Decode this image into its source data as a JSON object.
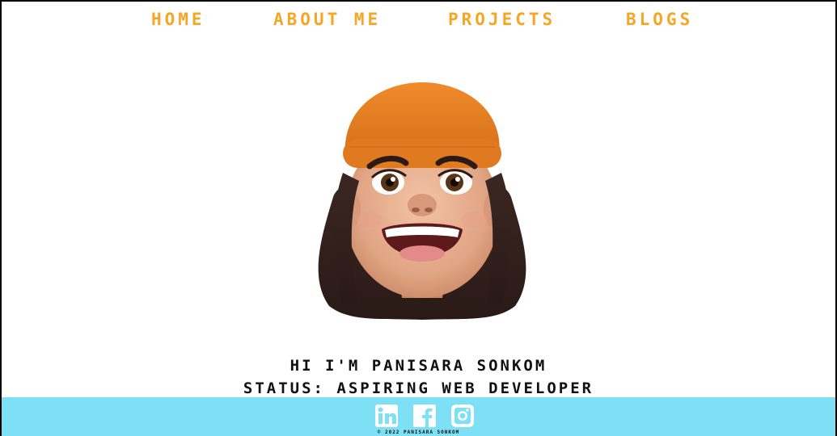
{
  "nav": {
    "items": [
      {
        "label": "HOME"
      },
      {
        "label": "ABOUT ME"
      },
      {
        "label": "PROJECTS"
      },
      {
        "label": "BLOGS"
      }
    ]
  },
  "hero": {
    "greeting": "HI I'M PANISARA SONKOM",
    "status": "STATUS: ASPIRING WEB DEVELOPER",
    "avatar_icon": "memoji-avatar"
  },
  "footer": {
    "social": [
      {
        "icon": "linkedin-icon"
      },
      {
        "icon": "facebook-icon"
      },
      {
        "icon": "instagram-icon"
      }
    ],
    "copyright": "© 2022 PANISARA SONKOM"
  },
  "colors": {
    "nav_text": "#f5a623",
    "footer_bg": "#7ee0f4",
    "body_text": "#111111",
    "background": "#ffffff"
  }
}
